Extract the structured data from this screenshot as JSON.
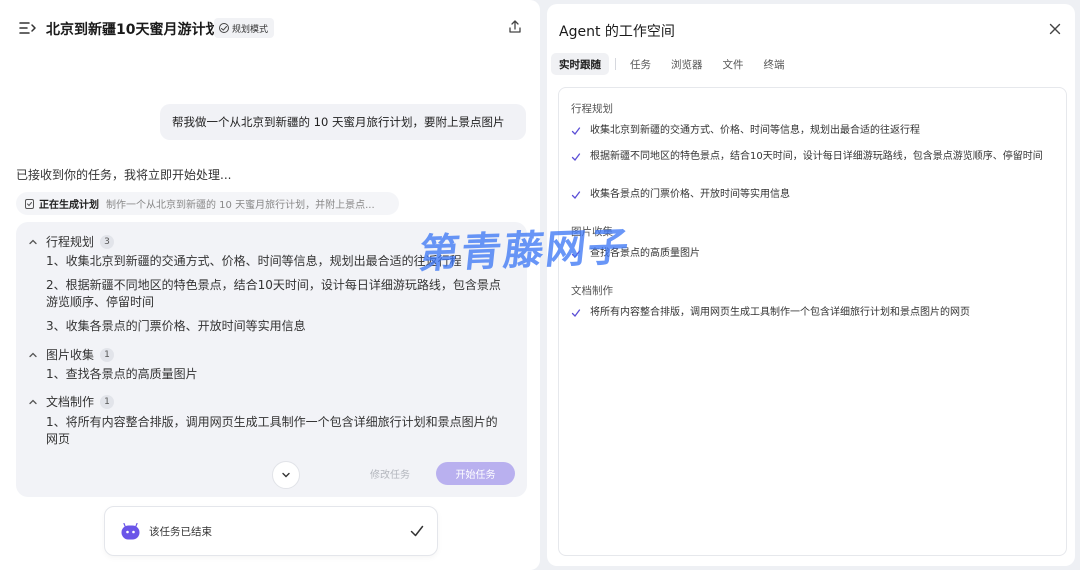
{
  "chat": {
    "title": "北京到新疆10天蜜月游计划",
    "mode_badge": "规划模式",
    "user_message": "帮我做一个从北京到新疆的 10 天蜜月旅行计划，要附上景点图片",
    "ack_text": "已接收到你的任务，我将立即开始处理...",
    "generating": {
      "label": "正在生成计划",
      "desc": "制作一个从北京到新疆的 10 天蜜月旅行计划，并附上景点..."
    },
    "plan": {
      "sections": [
        {
          "title": "行程规划",
          "count": "3",
          "steps": [
            "1、收集北京到新疆的交通方式、价格、时间等信息，规划出最合适的往返行程",
            "2、根据新疆不同地区的特色景点，结合10天时间，设计每日详细游玩路线，包含景点游览顺序、停留时间",
            "3、收集各景点的门票价格、开放时间等实用信息"
          ]
        },
        {
          "title": "图片收集",
          "count": "1",
          "steps": [
            "1、查找各景点的高质量图片"
          ]
        },
        {
          "title": "文档制作",
          "count": "1",
          "steps": [
            "1、将所有内容整合排版，调用网页生成工具制作一个包含详细旅行计划和景点图片的网页"
          ]
        }
      ],
      "modify_label": "修改任务",
      "start_label": "开始任务"
    },
    "ended_text": "该任务已结束"
  },
  "workspace": {
    "title": "Agent 的工作空间",
    "tabs": [
      "实时跟随",
      "任务",
      "浏览器",
      "文件",
      "终端"
    ],
    "active_tab": "实时跟随",
    "sections": [
      {
        "title": "行程规划",
        "items": [
          "收集北京到新疆的交通方式、价格、时间等信息，规划出最合适的往返行程",
          "根据新疆不同地区的特色景点，结合10天时间，设计每日详细游玩路线，包含景点游览顺序、停留时间",
          "收集各景点的门票价格、开放时间等实用信息"
        ]
      },
      {
        "title": "图片收集",
        "items": [
          "查找各景点的高质量图片"
        ]
      },
      {
        "title": "文档制作",
        "items": [
          "将所有内容整合排版，调用网页生成工具制作一个包含详细旅行计划和景点图片的网页"
        ]
      }
    ]
  },
  "watermark": "第青藤网子",
  "colors": {
    "accent": "#b9b0ef",
    "bot": "#6a55e8",
    "check": "#5b4fd6"
  }
}
